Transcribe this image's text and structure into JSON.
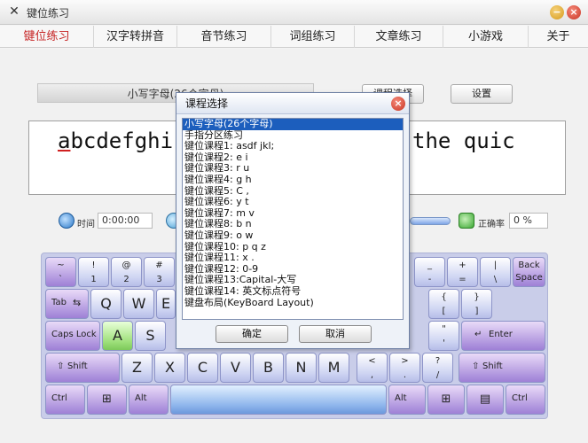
{
  "window": {
    "title": "键位练习"
  },
  "menu": [
    "键位练习",
    "汉字转拼音",
    "音节练习",
    "词组练习",
    "文章练习",
    "小游戏",
    "关于"
  ],
  "practice": {
    "lesson_label": "小写字母(26个字母)",
    "course_button": "课程选择",
    "settings_button": "设置",
    "text_left": "abcdefghi",
    "text_right": "the quic"
  },
  "stats": {
    "time_label": "时间",
    "time_value": "0:00:00",
    "accuracy_label": "正确率",
    "accuracy_value": "0 %"
  },
  "keyboard": {
    "row1": [
      {
        "top": "~",
        "bottom": "`"
      },
      {
        "top": "!",
        "bottom": "1"
      },
      {
        "top": "@",
        "bottom": "2"
      },
      {
        "top": "#",
        "bottom": "3"
      },
      {
        "top": "_",
        "bottom": "-"
      },
      {
        "top": "+",
        "bottom": "="
      },
      {
        "top": "|",
        "bottom": "\\"
      }
    ],
    "backspace": "Back Space",
    "tab": "Tab",
    "row2": [
      "Q",
      "W",
      "E"
    ],
    "row2_right": [
      {
        "top": "{",
        "bottom": "["
      },
      {
        "top": "}",
        "bottom": "]"
      }
    ],
    "capslock": "Caps Lock",
    "row3": [
      "A",
      "S"
    ],
    "row3_right": [
      {
        "top": "\"",
        "bottom": "'"
      }
    ],
    "enter": "Enter",
    "lshift": "Shift",
    "row4": [
      "Z",
      "X",
      "C",
      "V",
      "B",
      "N",
      "M"
    ],
    "row4_right": [
      {
        "top": "<",
        "bottom": ","
      },
      {
        "top": ">",
        "bottom": "."
      },
      {
        "top": "?",
        "bottom": "/"
      }
    ],
    "rshift": "Shift",
    "ctrl_left": "Ctrl",
    "alt_left": "Alt",
    "alt_right": "Alt",
    "ctrl_right": "Ctrl",
    "highlight_key": "A"
  },
  "dialog": {
    "title": "课程选择",
    "items": [
      "小写字母(26个字母)",
      "手指分区练习",
      "键位课程1: asdf jkl;",
      "键位课程2: e i",
      "键位课程3: r u",
      "键位课程4: g h",
      "键位课程5: C ,",
      "键位课程6: y t",
      "键位课程7: m v",
      "键位课程8: b n",
      "键位课程9: o w",
      "键位课程10: p q z",
      "键位课程11: x .",
      "键位课程12: 0-9",
      "键位课程13:Capital-大写",
      "键位课程14: 英文标点符号",
      "键盘布局(KeyBoard Layout)"
    ],
    "selected_index": 0,
    "ok": "确定",
    "cancel": "取消"
  }
}
